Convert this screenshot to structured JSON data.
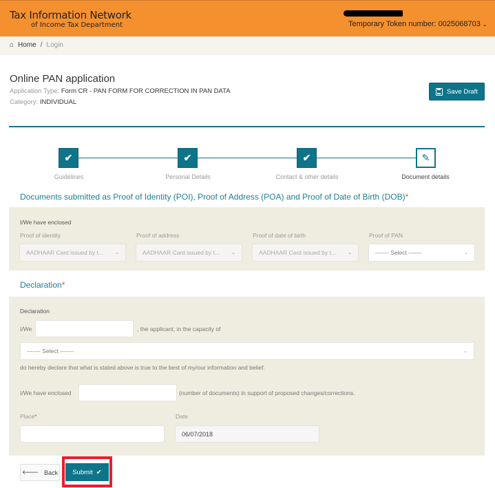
{
  "header": {
    "brand_line1": "Tax Information Network",
    "brand_line2": "of Income Tax Department",
    "token_label": "Temporary Token number: 0025068703",
    "token_chevron": "⌄",
    "bg_color": "#f5902f"
  },
  "breadcrumb": {
    "home_icon": "⌂",
    "items": [
      "Home",
      "Login"
    ],
    "separator": "/"
  },
  "page": {
    "title": "Online PAN application",
    "application_type_label": "Application Type:",
    "application_type_value": "Form CR - PAN FORM FOR CORRECTION IN PAN DATA",
    "category_label": "Category:",
    "category_value": "INDIVIDUAL",
    "save_draft_label": "Save Draft",
    "accent_color": "#0e7489"
  },
  "stepper": {
    "steps": [
      {
        "label": "Guidelines",
        "status": "done",
        "icon": "✔"
      },
      {
        "label": "Personal Details",
        "status": "done",
        "icon": "✔"
      },
      {
        "label": "Contact & other details",
        "status": "done",
        "icon": "✔"
      },
      {
        "label": "Document details",
        "status": "current",
        "icon": "✎"
      }
    ]
  },
  "documents": {
    "section_title": "Documents submitted as Proof of Identity (POI), Proof of Address (POA) and Proof of Date of Birth (DOB)",
    "required_mark": "*",
    "enclosed_label": "I/We have enclosed",
    "fields": [
      {
        "label": "Proof of identity",
        "value": "AADHAAR Card issued by t...",
        "disabled": true
      },
      {
        "label": "Proof of address",
        "value": "AADHAAR Card issued by t...",
        "disabled": true
      },
      {
        "label": "Proof of date of birth",
        "value": "AADHAAR Card issued by t...",
        "disabled": true
      },
      {
        "label": "Proof of PAN",
        "value": "------- Select -------",
        "disabled": false
      }
    ],
    "chevron": "⌄"
  },
  "declaration": {
    "section_title": "Declaration",
    "required_mark": "*",
    "panel_label": "Declaration",
    "iwe_label": "I/We",
    "name_value": "",
    "applicant_text": ", the applicant, in the capacity of",
    "capacity_select": "------- Select -------",
    "declare_text": "do hereby declare that what is stated above is true to the best of my/our information and belief.",
    "enclosed_label": "I/We have enclosed",
    "enclosed_value": "",
    "enclosed_suffix": "(number of documents) in support of proposed changes/corrections.",
    "place_label": "Place",
    "place_value": "",
    "date_label": "Date",
    "date_value": "06/07/2018"
  },
  "actions": {
    "back_label": "Back",
    "back_icon": "🡐",
    "submit_label": "Submit",
    "submit_icon": "✔",
    "highlight_color": "#e8202b"
  }
}
